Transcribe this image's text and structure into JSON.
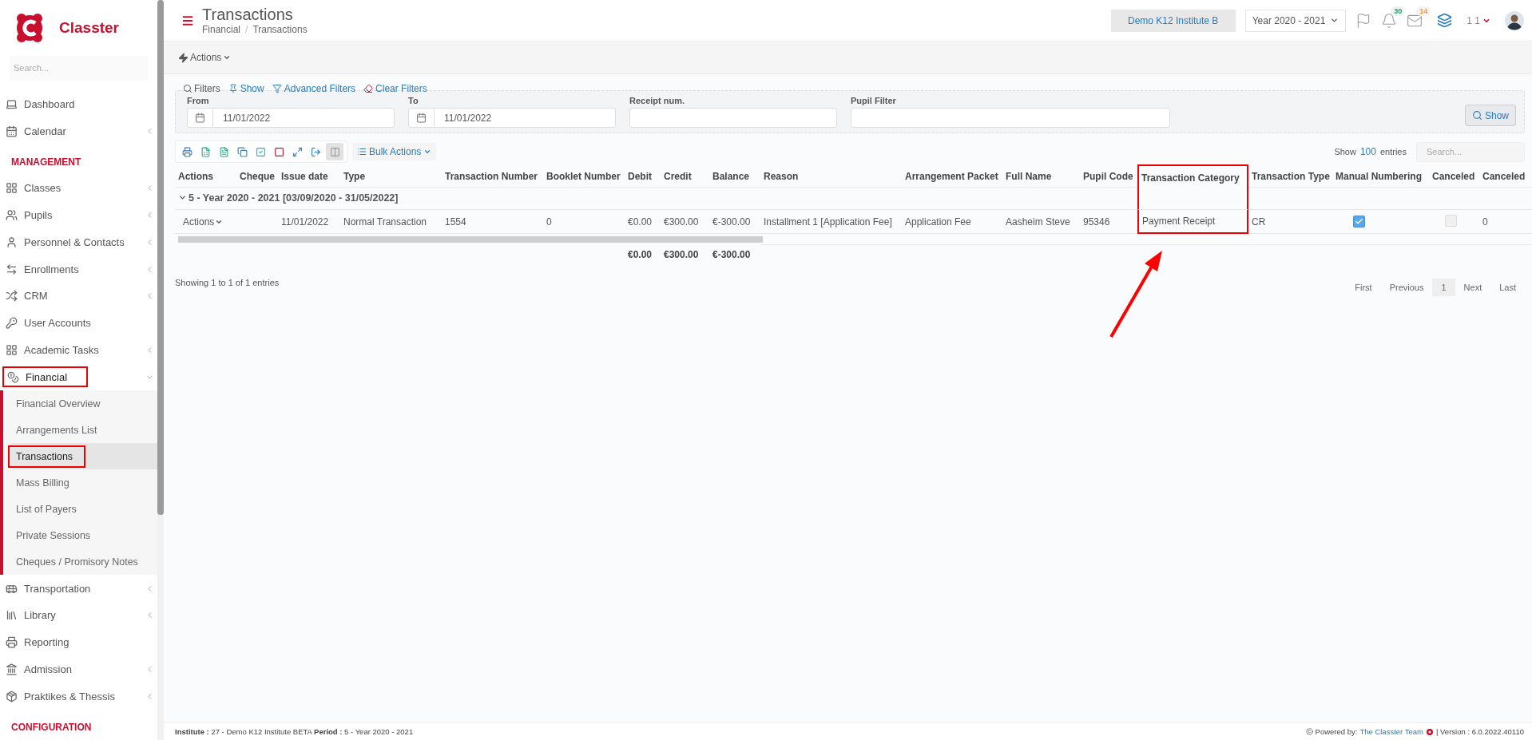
{
  "sidebar": {
    "brand": "Classter",
    "search_placeholder": "Search...",
    "items": [
      {
        "kind": "item",
        "label": "Dashboard"
      },
      {
        "kind": "item",
        "label": "Calendar",
        "expanded": false
      },
      {
        "kind": "heading",
        "label": "MANAGEMENT"
      },
      {
        "kind": "item",
        "label": "Classes",
        "expanded": false
      },
      {
        "kind": "item",
        "label": "Pupils",
        "expanded": false
      },
      {
        "kind": "item",
        "label": "Personnel & Contacts",
        "expanded": false
      },
      {
        "kind": "item",
        "label": "Enrollments",
        "expanded": false
      },
      {
        "kind": "item",
        "label": "CRM",
        "expanded": false
      },
      {
        "kind": "item",
        "label": "User Accounts"
      },
      {
        "kind": "item",
        "label": "Academic Tasks",
        "expanded": false
      },
      {
        "kind": "item",
        "label": "Financial",
        "expanded": true,
        "highlighted": true,
        "children": [
          {
            "label": "Financial Overview",
            "selected": false,
            "highlighted": false
          },
          {
            "label": "Arrangements List",
            "selected": false,
            "highlighted": false
          },
          {
            "label": "Transactions",
            "selected": true,
            "highlighted": true
          },
          {
            "label": "Mass Billing",
            "selected": false,
            "highlighted": false
          },
          {
            "label": "List of Payers",
            "selected": false,
            "highlighted": false
          },
          {
            "label": "Private Sessions",
            "selected": false,
            "highlighted": false
          },
          {
            "label": "Cheques / Promisory Notes",
            "selected": false,
            "highlighted": false
          }
        ]
      },
      {
        "kind": "item",
        "label": "Transportation",
        "expanded": false
      },
      {
        "kind": "item",
        "label": "Library",
        "expanded": false
      },
      {
        "kind": "item",
        "label": "Reporting"
      },
      {
        "kind": "item",
        "label": "Admission",
        "expanded": false
      },
      {
        "kind": "item",
        "label": "Praktikes & Thessis",
        "expanded": false
      },
      {
        "kind": "heading",
        "label": "CONFIGURATION"
      }
    ]
  },
  "header": {
    "title": "Transactions",
    "breadcrumb": [
      "Financial",
      "Transactions"
    ],
    "breadcrumb_separator": "/",
    "institute": "Demo K12 Institute B",
    "year": "Year 2020 - 2021",
    "notifications": "30",
    "messages": "14",
    "user": "1 1"
  },
  "actions_menu": "Actions",
  "filters": {
    "legend": "Filters",
    "links": [
      "Show",
      "Advanced Filters",
      "Clear Filters"
    ],
    "fields": [
      {
        "kind": "date",
        "label": "From",
        "value": "11/01/2022"
      },
      {
        "kind": "date",
        "label": "To",
        "value": "11/01/2022"
      },
      {
        "kind": "text",
        "label": "Receipt num."
      },
      {
        "kind": "wide",
        "label": "Pupil Filter"
      }
    ],
    "submit": "Show"
  },
  "toolbar": {
    "buttons": [
      {
        "selected": false
      },
      {
        "selected": false
      },
      {
        "selected": false
      },
      {
        "selected": false
      },
      {
        "selected": false
      },
      {
        "selected": false
      },
      {
        "selected": false
      },
      {
        "selected": false
      },
      {
        "selected": true
      }
    ],
    "bulk": "Bulk Actions",
    "show_label": "Show",
    "page_size": "100",
    "entries_label": "entries",
    "search_placeholder": "Search..."
  },
  "table": {
    "columns": [
      {
        "label": "Actions",
        "highlighted": false
      },
      {
        "label": "Cheque",
        "highlighted": false
      },
      {
        "label": "Issue date",
        "highlighted": false
      },
      {
        "label": "Type",
        "highlighted": false
      },
      {
        "label": "Transaction Number",
        "highlighted": false
      },
      {
        "label": "Booklet Number",
        "highlighted": false
      },
      {
        "label": "Debit",
        "highlighted": false
      },
      {
        "label": "Credit",
        "highlighted": false
      },
      {
        "label": "Balance",
        "highlighted": false
      },
      {
        "label": "Reason",
        "highlighted": false
      },
      {
        "label": "Arrangement Packet",
        "highlighted": false
      },
      {
        "label": "Full Name",
        "highlighted": false
      },
      {
        "label": "Pupil Code",
        "highlighted": false
      },
      {
        "label": "Transaction Category",
        "highlighted": true
      },
      {
        "label": "Transaction Type",
        "highlighted": false
      },
      {
        "label": "Manual Numbering",
        "highlighted": false
      },
      {
        "label": "Canceled",
        "highlighted": false
      },
      {
        "label": "Canceled",
        "highlighted": false
      }
    ],
    "group": {
      "label": "5 - Year 2020 - 2021 [03/09/2020 - 31/05/2022]",
      "expanded": true
    },
    "rows": [
      {
        "cells": [
          {
            "kind": "menu",
            "text": "Actions"
          },
          {
            "kind": "empty"
          },
          {
            "kind": "text",
            "text": "11/01/2022"
          },
          {
            "kind": "text",
            "text": "Normal Transaction"
          },
          {
            "kind": "text",
            "text": "1554"
          },
          {
            "kind": "text",
            "text": "0"
          },
          {
            "kind": "text",
            "text": "€0.00"
          },
          {
            "kind": "text",
            "text": "€300.00"
          },
          {
            "kind": "text",
            "text": "€-300.00"
          },
          {
            "kind": "text",
            "text": "Installment 1 [Application Fee]"
          },
          {
            "kind": "text",
            "text": "Application Fee"
          },
          {
            "kind": "text",
            "text": "Aasheim Steve"
          },
          {
            "kind": "text",
            "text": "95346"
          },
          {
            "kind": "text",
            "text": "Payment Receipt"
          },
          {
            "kind": "text",
            "text": "CR"
          },
          {
            "kind": "checkbox",
            "checked": true
          },
          {
            "kind": "checkbox",
            "checked": false
          },
          {
            "kind": "text",
            "text": "0"
          }
        ]
      }
    ],
    "totals": {
      "debit": "€0.00",
      "credit": "€300.00",
      "balance": "€-300.00"
    },
    "info": "Showing 1 to 1 of 1 entries"
  },
  "pagination": [
    {
      "label": "First",
      "selected": false
    },
    {
      "label": "Previous",
      "selected": false
    },
    {
      "label": "1",
      "selected": true
    },
    {
      "label": "Next",
      "selected": false
    },
    {
      "label": "Last",
      "selected": false
    }
  ],
  "annotation_arrow": true,
  "footer": {
    "info": "**Institute :** 27 - Demo K12 Institute BETA **Period :** 5 - Year 2020 - 2021",
    "powered_by": "Powered by:",
    "team": "The Classter Team",
    "version": "| Version : 6.0.2022.40110"
  }
}
